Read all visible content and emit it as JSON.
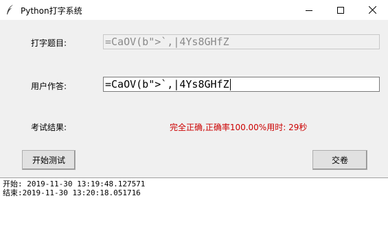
{
  "window": {
    "title": "Python打字系统"
  },
  "labels": {
    "question": "打字题目:",
    "answer": "用户作答:",
    "result": "考试结果:"
  },
  "fields": {
    "question_value": "=CaOV(b\">`,|4Ys8GHfZ",
    "answer_value": "=CaOV(b\">`,|4Ys8GHfZ"
  },
  "result": {
    "text": "完全正确,正确率100.00%用时: 29秒"
  },
  "buttons": {
    "start": "开始测试",
    "submit": "交卷"
  },
  "log": [
    "开始: 2019-11-30 13:19:48.127571",
    "结束:2019-11-30 13:20:18.051716"
  ],
  "colors": {
    "result_text": "#cc0000"
  }
}
